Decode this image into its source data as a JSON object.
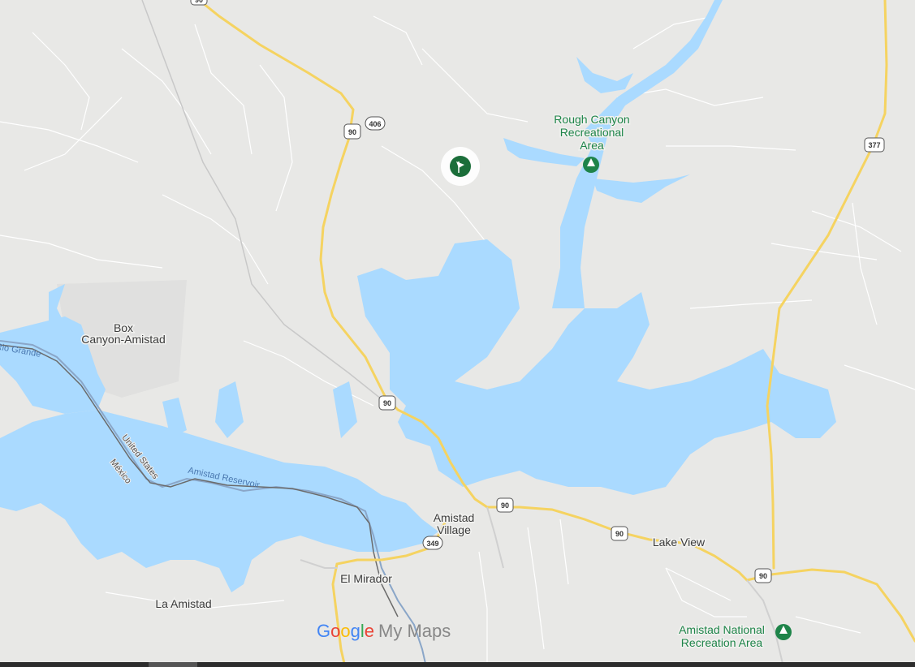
{
  "map": {
    "places": [
      {
        "id": "box-canyon",
        "lines": [
          "Box",
          "Canyon-Amistad"
        ]
      },
      {
        "id": "amistad-village",
        "lines": [
          "Amistad",
          "Village"
        ]
      },
      {
        "id": "el-mirador",
        "lines": [
          "El Mirador"
        ]
      },
      {
        "id": "la-amistad",
        "lines": [
          "La Amistad"
        ]
      },
      {
        "id": "lake-view",
        "lines": [
          "Lake View"
        ]
      }
    ],
    "parks": [
      {
        "id": "rough-canyon",
        "lines": [
          "Rough Canyon",
          "Recreational",
          "Area"
        ]
      },
      {
        "id": "amistad-nra",
        "lines": [
          "Amistad National",
          "Recreation Area"
        ]
      }
    ],
    "water_labels": {
      "reservoir": "Amistad Reservoir",
      "river": "Rio Grande"
    },
    "border_labels": {
      "us": "United States",
      "mx": "México"
    },
    "shields": {
      "us90": "90",
      "r406": "406",
      "us377": "377",
      "r349": "349"
    },
    "marker": {
      "icon": "golf-flag-icon",
      "color": "#1b6e3a"
    },
    "branding": {
      "google": "Google",
      "product": "My Maps"
    },
    "colors": {
      "land": "#e8e8e6",
      "water": "#aadaff",
      "highway": "#f5d361",
      "park": "#1e8449"
    }
  }
}
